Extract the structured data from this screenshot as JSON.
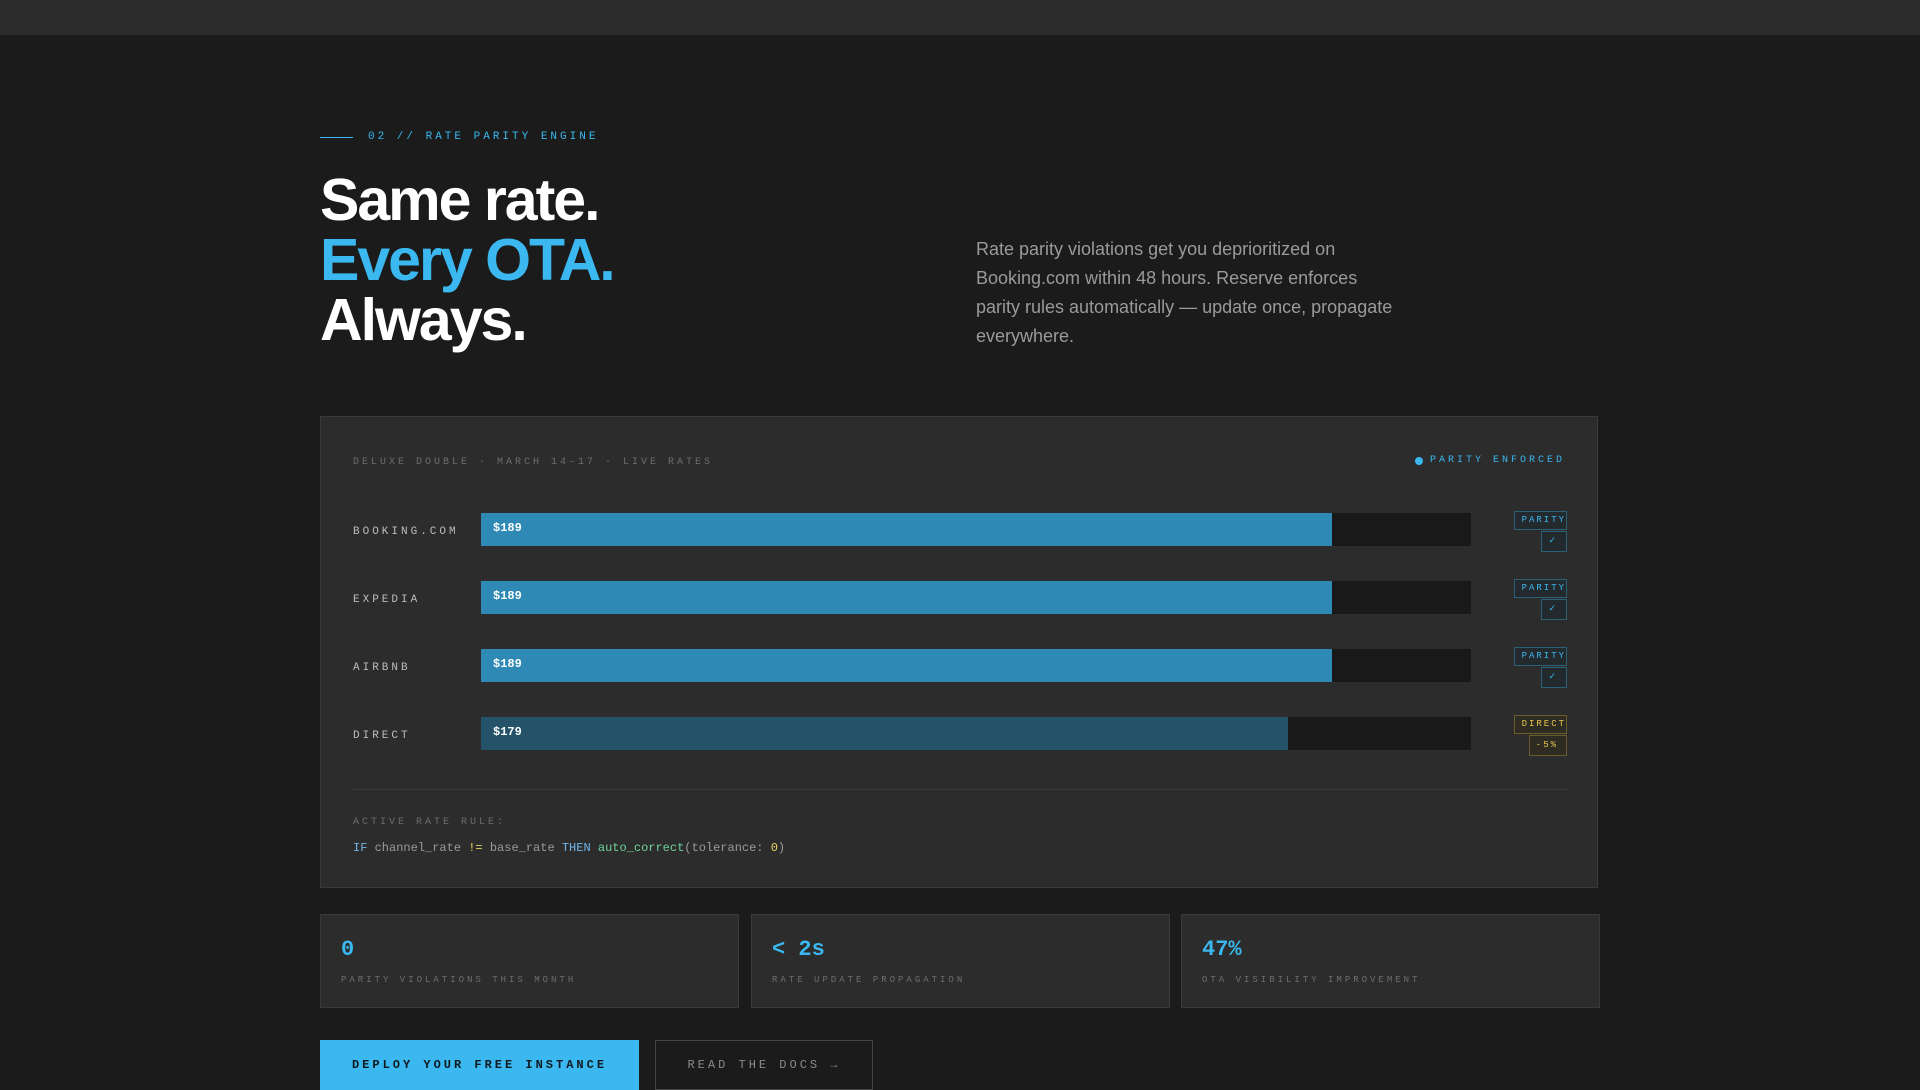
{
  "section": {
    "eyebrow": "02 // RATE PARITY ENGINE"
  },
  "headline": {
    "line1": "Same rate.",
    "line2": "Every OTA.",
    "line3": "Always."
  },
  "intro": "Rate parity violations get you deprioritized on Booking.com within 48 hours. Reserve enforces parity rules automatically — update once, propagate everywhere.",
  "panel": {
    "header": "DELUXE DOUBLE · MARCH 14–17 · LIVE RATES",
    "status": "PARITY ENFORCED",
    "rows": [
      {
        "channel": "BOOKING.COM",
        "price": "$189",
        "fill": 0.86,
        "badge_top": "PARITY",
        "badge_bottom": "✓"
      },
      {
        "channel": "EXPEDIA",
        "price": "$189",
        "fill": 0.86,
        "badge_top": "PARITY",
        "badge_bottom": "✓"
      },
      {
        "channel": "AIRBNB",
        "price": "$189",
        "fill": 0.86,
        "badge_top": "PARITY",
        "badge_bottom": "✓"
      },
      {
        "channel": "DIRECT",
        "price": "$179",
        "fill": 0.815,
        "badge_top": "DIRECT",
        "badge_bottom": "-5%"
      }
    ],
    "rule_label": "ACTIVE RATE RULE:",
    "rule": {
      "if": "IF",
      "left": "channel_rate",
      "op": "!=",
      "right": "base_rate",
      "then": "THEN",
      "fn": "auto_correct",
      "arg_name": "tolerance:",
      "arg_value": "0"
    }
  },
  "stats": [
    {
      "value": "0",
      "caption": "PARITY VIOLATIONS THIS MONTH"
    },
    {
      "value": "< 2s",
      "caption": "RATE UPDATE PROPAGATION"
    },
    {
      "value": "47%",
      "caption": "OTA VISIBILITY IMPROVEMENT"
    }
  ],
  "cta": {
    "primary": "DEPLOY YOUR FREE INSTANCE",
    "secondary": "READ THE DOCS →"
  },
  "colors": {
    "accent": "#3ab8ef",
    "direct": "#e5c44b",
    "background": "#1b1b1b",
    "panel": "#2c2c2c"
  }
}
